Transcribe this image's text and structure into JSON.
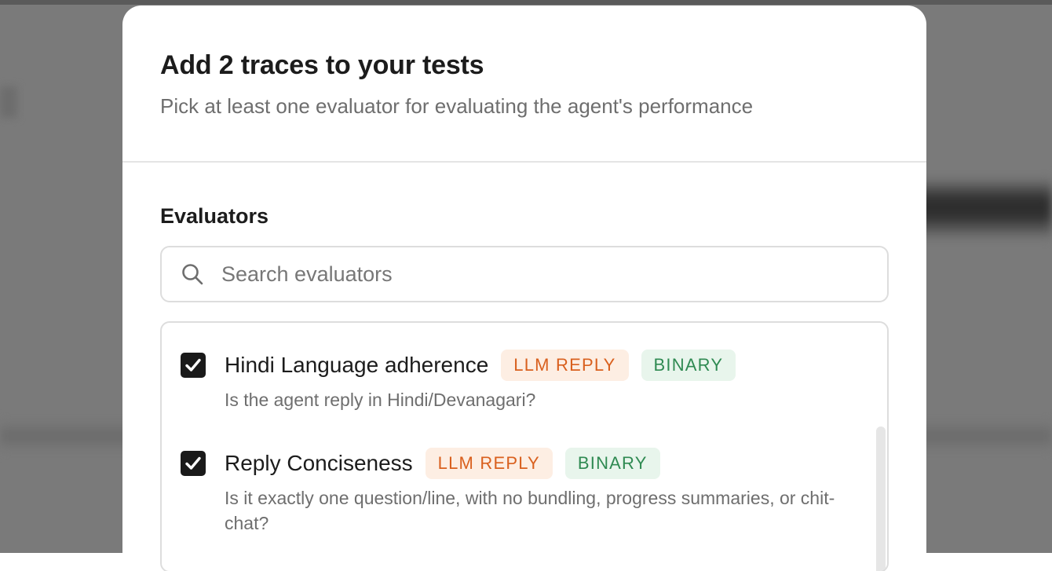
{
  "dialog": {
    "title": "Add 2 traces to your tests",
    "subtitle": "Pick at least one evaluator for evaluating the agent's performance"
  },
  "evaluators_section": {
    "label": "Evaluators",
    "search": {
      "placeholder": "Search evaluators",
      "value": "",
      "icon": "search-icon"
    },
    "items": [
      {
        "checked": true,
        "name": "Hindi Language adherence",
        "badges": [
          {
            "label": "LLM REPLY",
            "color": "#d9601e",
            "background": "#fdeee3"
          },
          {
            "label": "BINARY",
            "color": "#2f8a52",
            "background": "#e8f5ec"
          }
        ],
        "description": "Is the agent reply in Hindi/Devanagari?"
      },
      {
        "checked": true,
        "name": "Reply Conciseness",
        "badges": [
          {
            "label": "LLM REPLY",
            "color": "#d9601e",
            "background": "#fdeee3"
          },
          {
            "label": "BINARY",
            "color": "#2f8a52",
            "background": "#e8f5ec"
          }
        ],
        "description": "Is it exactly one question/line, with no bundling, progress summaries, or chit-chat?"
      }
    ]
  }
}
